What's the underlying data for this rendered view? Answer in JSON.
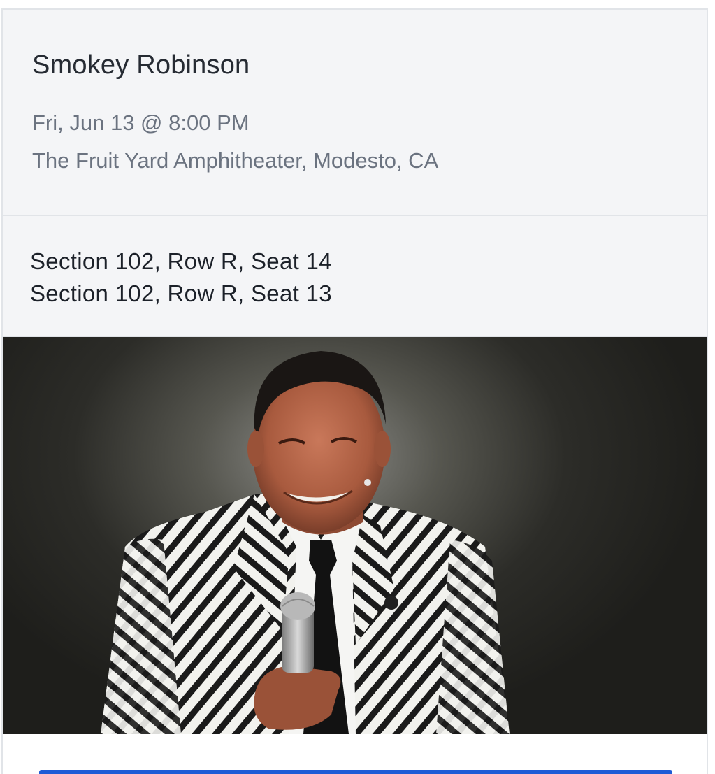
{
  "event": {
    "title": "Smokey Robinson",
    "datetime": "Fri, Jun 13 @ 8:00 PM",
    "venue": "The Fruit Yard Amphitheater, Modesto, CA"
  },
  "seats": [
    "Section 102, Row R, Seat 14",
    "Section 102, Row R, Seat 13"
  ],
  "hero_image": {
    "subject": "performer-photo"
  },
  "colors": {
    "accent": "#1e5bd6",
    "title": "#262b33",
    "secondary_text": "#6b7380",
    "panel_bg": "#f4f5f7"
  }
}
